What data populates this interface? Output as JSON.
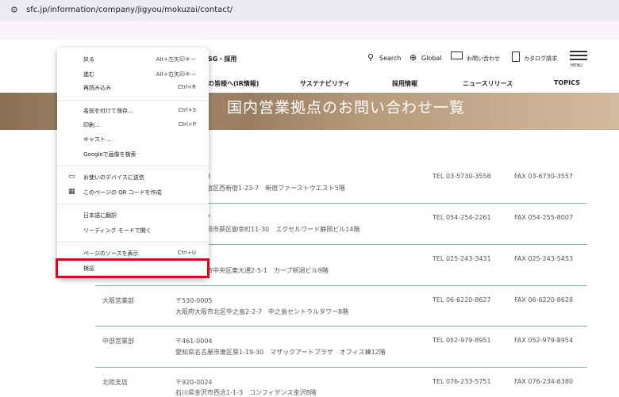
{
  "browser": {
    "url": "sfc.jp/information/company/jigyou/mokuzai/contact/"
  },
  "header": {
    "top_label": "SG・採用",
    "search": "Search",
    "global": "Global",
    "contact": "お問い合わせ",
    "catalog": "カタログ請求",
    "menu": "MENU"
  },
  "nav": {
    "items": [
      "の皆様へ(IR情報)",
      "サステナビリティ",
      "採用情報",
      "ニュースリリース",
      "TOPICS"
    ]
  },
  "hero": {
    "title": "国内営業拠点のお問い合わせ一覧"
  },
  "offices": [
    {
      "name": "",
      "zip": "3",
      "address": "宿区西新宿1-23-7　新宿ファーストウエスト5階",
      "tel": "TEL 03-5730-3558",
      "fax": "FAX 03-6730-3557"
    },
    {
      "name": "",
      "zip": "7",
      "address": "岡市葵区御幸町11-30　エクセルワード静岡ビル14階",
      "tel": "TEL 054-254-2261",
      "fax": "FAX 054-255-8007"
    },
    {
      "name": "",
      "zip": "",
      "address": "市中央区東大通2-5-1　カープ新潟ビル9階",
      "tel": "TEL 025-243-3431",
      "fax": "FAX 025-243-5453"
    },
    {
      "name": "大阪営業部",
      "zip": "〒530-0005",
      "address": "大阪府大阪市北区中之島2-2-7　中之島セントラルタワー8階",
      "tel": "TEL 06-6220-8627",
      "fax": "FAX 06-6220-8628"
    },
    {
      "name": "中部営業部",
      "zip": "〒461-0004",
      "address": "愛知県名古屋市東区葵1-19-30　マザックアートプラザ　オフィス棟12階",
      "tel": "TEL 052-979-8951",
      "fax": "FAX 052-979-8954"
    },
    {
      "name": "北陸支店",
      "zip": "〒920-0024",
      "address": "石川県金沢市西念1-1-3　コンフィデンス金沢8階",
      "tel": "TEL 076-233-5751",
      "fax": "FAX 076-234-6380"
    }
  ],
  "context_menu": {
    "items": [
      {
        "label": "戻る",
        "shortcut": "Alt+左矢印キー"
      },
      {
        "label": "進む",
        "shortcut": "Alt+右矢印キー"
      },
      {
        "label": "再読み込み",
        "shortcut": "Ctrl+R"
      },
      {
        "label": "名前を付けて保存...",
        "shortcut": "Ctrl+S"
      },
      {
        "label": "印刷...",
        "shortcut": "Ctrl+P"
      },
      {
        "label": "キャスト...",
        "shortcut": ""
      },
      {
        "label": "Googleで画像を検索",
        "shortcut": ""
      },
      {
        "label": "お使いのデバイスに送信",
        "shortcut": ""
      },
      {
        "label": "このページの QR コードを作成",
        "shortcut": ""
      },
      {
        "label": "日本語に翻訳",
        "shortcut": ""
      },
      {
        "label": "リーディング モードで開く",
        "shortcut": ""
      },
      {
        "label": "ページのソースを表示",
        "shortcut": "Ctrl+U"
      },
      {
        "label": "検証",
        "shortcut": ""
      }
    ]
  },
  "colors": {
    "highlight_box": "#e0001b",
    "row_separator": "#7fb3a6"
  }
}
